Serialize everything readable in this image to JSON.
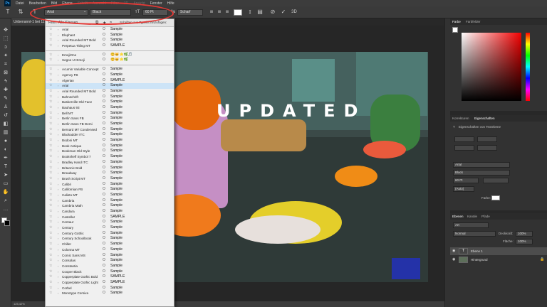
{
  "menubar": {
    "app_logo": "Ps",
    "items": [
      "Datei",
      "Bearbeiten",
      "Bild",
      "Ebene",
      "Schrift",
      "Auswahl",
      "Filter",
      "3D",
      "Ansicht",
      "Fenster",
      "Hilfe"
    ]
  },
  "options": {
    "font_family": "Arial",
    "font_style": "Black",
    "font_size": "60 Pt",
    "anti_alias": "Scharf",
    "icons": [
      "text-tool-icon",
      "orientation-icon",
      "align-left-icon",
      "align-center-icon",
      "align-right-icon",
      "cancel-icon",
      "commit-icon",
      "3d-icon"
    ]
  },
  "document": {
    "tab_title": "Unbenannt-1 bei 11",
    "zoom": "125,42%",
    "headline": "UPDATED"
  },
  "font_menu": {
    "filter_label": "Filter: Alle Klassen",
    "adobe_label": "Schriften aus Typekit hinzufügen:",
    "fonts_group1": [
      {
        "name": "Arial",
        "sample": "Sample"
      },
      {
        "name": "Elephant",
        "sample": "Sample"
      },
      {
        "name": "Arial Rounded MT Bold",
        "sample": "Sample"
      },
      {
        "name": "Perpetua Titling MT",
        "sample": "SAMPLE"
      }
    ],
    "fonts_group2": [
      {
        "name": "EmojiOne",
        "sample": "😊🐱⭐🌿🎵"
      },
      {
        "name": "Segoe UI Emoji",
        "sample": "😊🐱⭐🌿"
      }
    ],
    "fonts_group3": [
      {
        "name": "Acumin Variable Concept",
        "sample": "Sample"
      },
      {
        "name": "Agency FB",
        "sample": "Sample"
      },
      {
        "name": "Algerian",
        "sample": "SAMPLE"
      },
      {
        "name": "Arial",
        "sample": "Sample"
      },
      {
        "name": "Arial Rounded MT Bold",
        "sample": "Sample"
      },
      {
        "name": "Bahnschrift",
        "sample": "Sample"
      },
      {
        "name": "Baskerville Old Face",
        "sample": "Sample"
      },
      {
        "name": "Bauhaus 93",
        "sample": "Sample"
      },
      {
        "name": "Bell MT",
        "sample": "Sample"
      },
      {
        "name": "Berlin Sans FB",
        "sample": "Sample"
      },
      {
        "name": "Berlin Sans FB Demi",
        "sample": "Sample"
      },
      {
        "name": "Bernard MT Condensed",
        "sample": "Sample"
      },
      {
        "name": "Blackadder ITC",
        "sample": "Sample"
      },
      {
        "name": "Bodoni MT",
        "sample": "Sample"
      },
      {
        "name": "Book Antiqua",
        "sample": "Sample"
      },
      {
        "name": "Bookman Old Style",
        "sample": "Sample"
      },
      {
        "name": "Bookshelf Symbol 7",
        "sample": "Sample"
      },
      {
        "name": "Bradley Hand ITC",
        "sample": "Sample"
      },
      {
        "name": "Britannic Bold",
        "sample": "Sample"
      },
      {
        "name": "Broadway",
        "sample": "Sample"
      },
      {
        "name": "Brush Script MT",
        "sample": "Sample"
      },
      {
        "name": "Calibri",
        "sample": "Sample"
      },
      {
        "name": "Californian FB",
        "sample": "Sample"
      },
      {
        "name": "Calisto MT",
        "sample": "Sample"
      },
      {
        "name": "Cambria",
        "sample": "Sample"
      },
      {
        "name": "Cambria Math",
        "sample": "Sample"
      },
      {
        "name": "Candara",
        "sample": "Sample"
      },
      {
        "name": "Castellar",
        "sample": "SAMPLE"
      },
      {
        "name": "Centaur",
        "sample": "Sample"
      },
      {
        "name": "Century",
        "sample": "Sample"
      },
      {
        "name": "Century Gothic",
        "sample": "Sample"
      },
      {
        "name": "Century Schoolbook",
        "sample": "Sample"
      },
      {
        "name": "Chiller",
        "sample": "Sample"
      },
      {
        "name": "Colonna MT",
        "sample": "Sample"
      },
      {
        "name": "Comic Sans MS",
        "sample": "Sample"
      },
      {
        "name": "Consolas",
        "sample": "Sample"
      },
      {
        "name": "Constantia",
        "sample": "Sample"
      },
      {
        "name": "Cooper Black",
        "sample": "Sample"
      },
      {
        "name": "Copperplate Gothic Bold",
        "sample": "SAMPLE"
      },
      {
        "name": "Copperplate Gothic Light",
        "sample": "SAMPLE"
      },
      {
        "name": "Corbel",
        "sample": "Sample"
      },
      {
        "name": "Monotype Corsiva",
        "sample": "Sample"
      }
    ]
  },
  "panels": {
    "color_tabs": [
      "Farbe",
      "Farbfelder"
    ],
    "props_tabs": [
      "Korrekturen",
      "Eigenschaften"
    ],
    "props_subtitle": "Eigenschaften von Textebene",
    "props_font": "Arial",
    "props_style": "Black",
    "props_size": "60 Pt",
    "props_leading": "(Auto)",
    "props_color_label": "Farbe:",
    "layers_tabs": [
      "Ebenen",
      "Kanäle",
      "Pfade"
    ],
    "layers_search": "Art",
    "blend_mode": "Normal",
    "opacity_label": "Deckkraft:",
    "opacity_value": "100%",
    "fill_label": "Fläche:",
    "fill_value": "100%",
    "layers": [
      {
        "name": "Ebene 1"
      },
      {
        "name": "Hintergrund"
      }
    ]
  },
  "colors": {
    "highlight_ellipse": "#e53935",
    "text": "#ffffff"
  }
}
